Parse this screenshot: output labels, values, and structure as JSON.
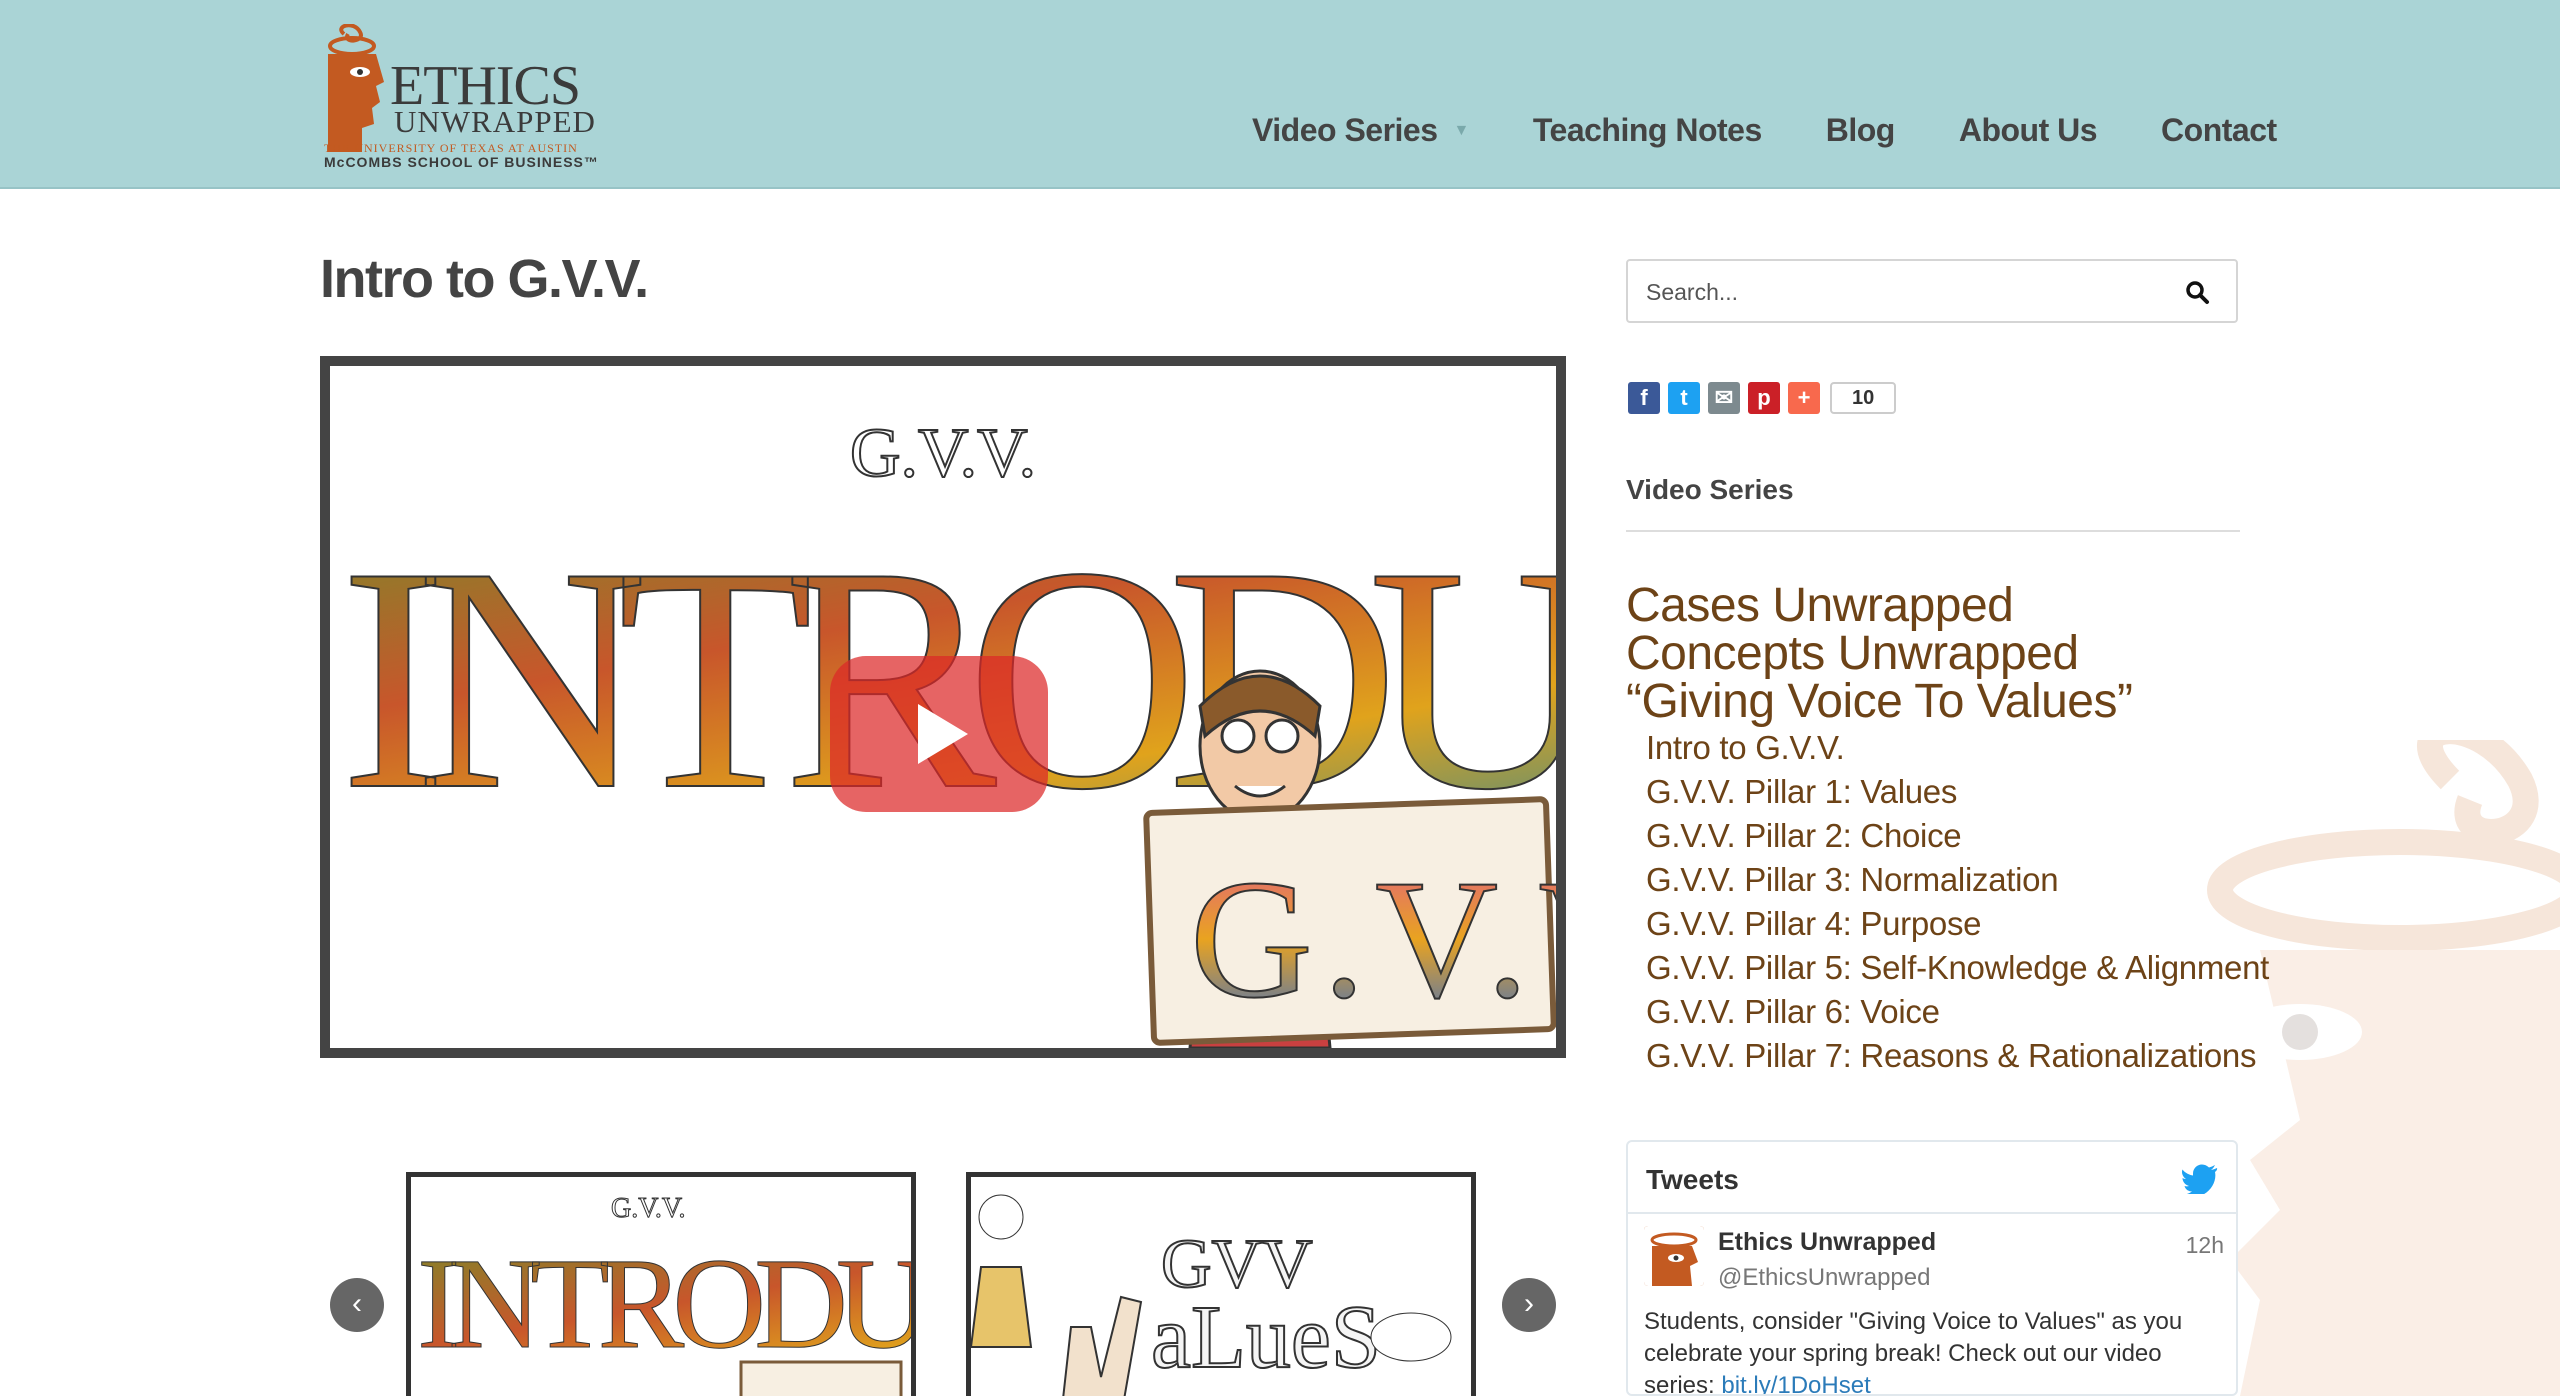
{
  "header": {
    "logo": {
      "line1": "ETHICS",
      "line2": "UNWRAPPED",
      "line3": "THE UNIVERSITY OF TEXAS AT AUSTIN",
      "line4": "McCOMBS SCHOOL OF BUSINESS™"
    },
    "nav": [
      {
        "label": "Video Series",
        "has_dropdown": true
      },
      {
        "label": "Teaching Notes"
      },
      {
        "label": "Blog"
      },
      {
        "label": "About Us"
      },
      {
        "label": "Contact"
      }
    ]
  },
  "main": {
    "title": "Intro to G.V.V.",
    "video": {
      "icon": "play-icon"
    },
    "carousel": {
      "prev_icon": "chevron-left-icon",
      "next_icon": "chevron-right-icon"
    }
  },
  "sidebar": {
    "search": {
      "placeholder": "Search...",
      "value": ""
    },
    "share": {
      "buttons": [
        "facebook-icon",
        "twitter-icon",
        "email-icon",
        "pinterest-icon",
        "plus-icon"
      ],
      "count": "10"
    },
    "video_series": {
      "heading": "Video Series",
      "items": [
        {
          "label": "Cases Unwrapped"
        },
        {
          "label": "Concepts Unwrapped"
        },
        {
          "label": "“Giving Voice To Values”"
        }
      ],
      "subitems": [
        {
          "label": "Intro to G.V.V."
        },
        {
          "label": "G.V.V. Pillar 1: Values"
        },
        {
          "label": "G.V.V. Pillar 2: Choice"
        },
        {
          "label": "G.V.V. Pillar 3: Normalization"
        },
        {
          "label": "G.V.V. Pillar 4: Purpose"
        },
        {
          "label": "G.V.V. Pillar 5: Self-Knowledge & Alignment"
        },
        {
          "label": "G.V.V. Pillar 6: Voice"
        },
        {
          "label": "G.V.V. Pillar 7: Reasons & Rationalizations"
        }
      ]
    },
    "tweets": {
      "title": "Tweets",
      "tweet": {
        "name": "Ethics Unwrapped",
        "handle": "@EthicsUnwrapped",
        "time": "12h",
        "text": "Students, consider \"Giving Voice to Values\" as you celebrate your spring break! Check out our video series: ",
        "link": "bit.ly/1DoHset"
      }
    }
  },
  "colors": {
    "header_bg": "#aad4d6",
    "accent_brown": "#6d4317",
    "logo_orange": "#c35a21",
    "twitter_blue": "#1da1f2"
  }
}
